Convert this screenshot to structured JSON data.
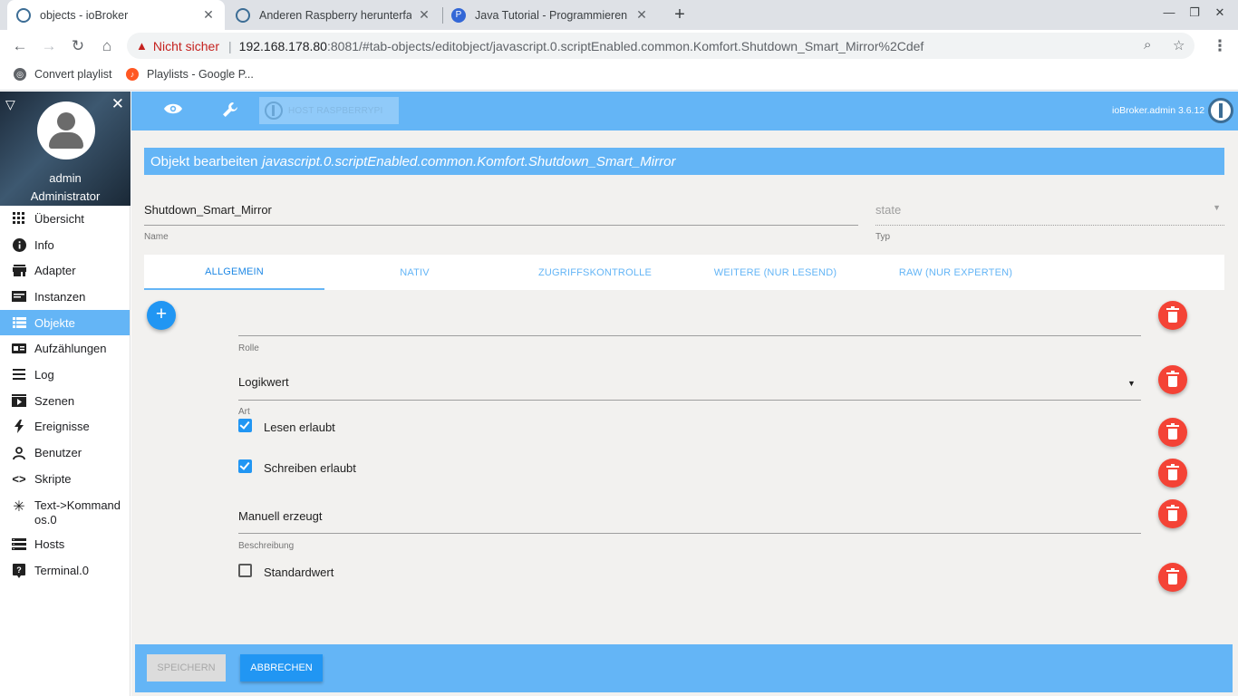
{
  "browser": {
    "tabs": [
      {
        "title": "objects - ioBroker",
        "active": true
      },
      {
        "title": "Anderen Raspberry herunterfahren",
        "active": false
      },
      {
        "title": "Java Tutorial - Programmieren lernen",
        "active": false
      }
    ],
    "not_secure_label": "Nicht sicher",
    "url_host": "192.168.178.80",
    "url_rest": ":8081/#tab-objects/editobject/javascript.0.scriptEnabled.common.Komfort.Shutdown_Smart_Mirror%2Cdef",
    "bookmarks": [
      {
        "label": "Convert playlist"
      },
      {
        "label": "Playlists - Google P..."
      }
    ]
  },
  "sidebar": {
    "user_name": "admin",
    "user_role": "Administrator",
    "items": [
      {
        "label": "Übersicht",
        "icon": "grid-icon"
      },
      {
        "label": "Info",
        "icon": "info-icon"
      },
      {
        "label": "Adapter",
        "icon": "store-icon"
      },
      {
        "label": "Instanzen",
        "icon": "instances-icon"
      },
      {
        "label": "Objekte",
        "icon": "list-icon",
        "active": true
      },
      {
        "label": "Aufzählungen",
        "icon": "enum-icon"
      },
      {
        "label": "Log",
        "icon": "log-icon"
      },
      {
        "label": "Szenen",
        "icon": "scenes-icon"
      },
      {
        "label": "Ereignisse",
        "icon": "bolt-icon"
      },
      {
        "label": "Benutzer",
        "icon": "user-icon"
      },
      {
        "label": "Skripte",
        "icon": "code-icon"
      },
      {
        "label": "Text->Kommandos.0",
        "icon": "snowflake-icon"
      },
      {
        "label": "Hosts",
        "icon": "hosts-icon"
      },
      {
        "label": "Terminal.0",
        "icon": "terminal-icon"
      }
    ]
  },
  "appbar": {
    "host_button": "HOST RASPBERRYPI",
    "version": "ioBroker.admin 3.6.12"
  },
  "editor": {
    "header_prefix": "Objekt bearbeiten",
    "object_id": "javascript.0.scriptEnabled.common.Komfort.Shutdown_Smart_Mirror",
    "name_value": "Shutdown_Smart_Mirror",
    "name_label": "Name",
    "type_value": "state",
    "type_label": "Typ",
    "tabs": [
      "ALLGEMEIN",
      "NATIV",
      "ZUGRIFFSKONTROLLE",
      "WEITERE (NUR LESEND)",
      "RAW (NUR EXPERTEN)"
    ],
    "active_tab": "ALLGEMEIN",
    "role_value": "",
    "role_label": "Rolle",
    "art_value": "Logikwert",
    "art_label": "Art",
    "read_label": "Lesen erlaubt",
    "read_checked": true,
    "write_label": "Schreiben erlaubt",
    "write_checked": true,
    "desc_value": "Manuell erzeugt",
    "desc_label": "Beschreibung",
    "default_label": "Standardwert",
    "default_checked": false
  },
  "footer": {
    "save_label": "SPEICHERN",
    "cancel_label": "ABBRECHEN"
  },
  "colors": {
    "accent": "#64b5f6",
    "primary_button": "#2196f3",
    "delete": "#f44336"
  }
}
